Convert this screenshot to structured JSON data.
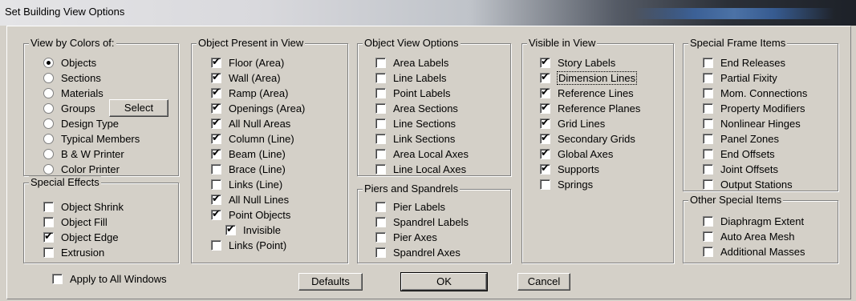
{
  "window": {
    "title": "Set Building View Options"
  },
  "view_by_colors": {
    "legend": "View by Colors of:",
    "options": [
      {
        "label": "Objects",
        "selected": true
      },
      {
        "label": "Sections",
        "selected": false
      },
      {
        "label": "Materials",
        "selected": false
      },
      {
        "label": "Groups",
        "selected": false
      },
      {
        "label": "Design Type",
        "selected": false
      },
      {
        "label": "Typical Members",
        "selected": false
      },
      {
        "label": "B & W Printer",
        "selected": false
      },
      {
        "label": "Color Printer",
        "selected": false
      }
    ],
    "select_button": "Select"
  },
  "special_effects": {
    "legend": "Special Effects",
    "items": [
      {
        "label": "Object Shrink",
        "checked": false
      },
      {
        "label": "Object Fill",
        "checked": false
      },
      {
        "label": "Object Edge",
        "checked": true
      },
      {
        "label": "Extrusion",
        "checked": false
      }
    ]
  },
  "object_present": {
    "legend": "Object Present in View",
    "items": [
      {
        "label": "Floor (Area)",
        "checked": true
      },
      {
        "label": "Wall (Area)",
        "checked": true
      },
      {
        "label": "Ramp (Area)",
        "checked": true
      },
      {
        "label": "Openings (Area)",
        "checked": true
      },
      {
        "label": "All Null Areas",
        "checked": true
      },
      {
        "label": "Column (Line)",
        "checked": true
      },
      {
        "label": "Beam (Line)",
        "checked": true
      },
      {
        "label": "Brace (Line)",
        "checked": false
      },
      {
        "label": "Links (Line)",
        "checked": false
      },
      {
        "label": "All Null Lines",
        "checked": true
      },
      {
        "label": "Point Objects",
        "checked": true
      },
      {
        "label": "Invisible",
        "checked": true
      },
      {
        "label": "Links (Point)",
        "checked": false
      }
    ]
  },
  "object_view_options": {
    "legend": "Object View Options",
    "items": [
      {
        "label": "Area Labels",
        "checked": false
      },
      {
        "label": "Line Labels",
        "checked": false
      },
      {
        "label": "Point Labels",
        "checked": false
      },
      {
        "label": "Area Sections",
        "checked": false
      },
      {
        "label": "Line Sections",
        "checked": false
      },
      {
        "label": "Link Sections",
        "checked": false
      },
      {
        "label": "Area Local Axes",
        "checked": false
      },
      {
        "label": "Line Local Axes",
        "checked": false
      }
    ]
  },
  "piers_spandrels": {
    "legend": "Piers and Spandrels",
    "items": [
      {
        "label": "Pier Labels",
        "checked": false
      },
      {
        "label": "Spandrel Labels",
        "checked": false
      },
      {
        "label": "Pier Axes",
        "checked": false
      },
      {
        "label": "Spandrel Axes",
        "checked": false
      }
    ]
  },
  "visible_in_view": {
    "legend": "Visible in View",
    "items": [
      {
        "label": "Story Labels",
        "checked": true
      },
      {
        "label": "Dimension Lines",
        "checked": true
      },
      {
        "label": "Reference Lines",
        "checked": true
      },
      {
        "label": "Reference Planes",
        "checked": true
      },
      {
        "label": "Grid Lines",
        "checked": true
      },
      {
        "label": "Secondary Grids",
        "checked": true
      },
      {
        "label": "Global Axes",
        "checked": true
      },
      {
        "label": "Supports",
        "checked": true
      },
      {
        "label": "Springs",
        "checked": false
      }
    ]
  },
  "special_frame_items": {
    "legend": "Special Frame Items",
    "items": [
      {
        "label": "End Releases",
        "checked": false
      },
      {
        "label": "Partial Fixity",
        "checked": false
      },
      {
        "label": "Mom. Connections",
        "checked": false
      },
      {
        "label": "Property Modifiers",
        "checked": false
      },
      {
        "label": "Nonlinear Hinges",
        "checked": false
      },
      {
        "label": "Panel Zones",
        "checked": false
      },
      {
        "label": "End Offsets",
        "checked": false
      },
      {
        "label": "Joint Offsets",
        "checked": false
      },
      {
        "label": "Output Stations",
        "checked": false
      }
    ]
  },
  "other_special_items": {
    "legend": "Other Special Items",
    "items": [
      {
        "label": "Diaphragm Extent",
        "checked": false
      },
      {
        "label": "Auto Area Mesh",
        "checked": false
      },
      {
        "label": "Additional Masses",
        "checked": false
      }
    ]
  },
  "footer": {
    "apply_all": {
      "label": "Apply to All Windows",
      "checked": false
    },
    "defaults_button": "Defaults",
    "ok_button": "OK",
    "cancel_button": "Cancel"
  }
}
